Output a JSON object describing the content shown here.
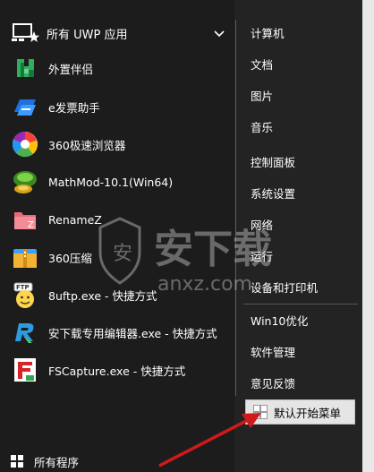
{
  "header": {
    "label": "所有 UWP 应用"
  },
  "apps": [
    {
      "label": "外置伴侣",
      "icon": "green-app-icon"
    },
    {
      "label": "e发票助手",
      "icon": "blue-invoice-icon"
    },
    {
      "label": "360极速浏览器",
      "icon": "360-browser-icon"
    },
    {
      "label": "MathMod-10.1(Win64)",
      "icon": "mathmod-icon"
    },
    {
      "label": "RenameZ",
      "icon": "renamez-icon"
    },
    {
      "label": "360压缩",
      "icon": "360-zip-icon"
    },
    {
      "label": "8uftp.exe - 快捷方式",
      "icon": "8uftp-icon"
    },
    {
      "label": "安下载专用编辑器.exe - 快捷方式",
      "icon": "editor-icon"
    },
    {
      "label": "FSCapture.exe - 快捷方式",
      "icon": "fscapture-icon"
    }
  ],
  "all_programs": "所有程序",
  "right_menu": {
    "group1": [
      "计算机",
      "文档",
      "图片",
      "音乐",
      "控制面板",
      "系统设置",
      "网络",
      "运行",
      "设备和打印机"
    ],
    "group2": [
      "Win10优化",
      "软件管理",
      "意见反馈"
    ],
    "default_menu": "默认开始菜单"
  },
  "watermark": {
    "text_cn": "安下载",
    "text_en": "anxz.com"
  },
  "colors": {
    "accent_arrow": "#d01a1a",
    "menu_bg": "#1c1c1c",
    "highlight": "#e5e5e5"
  }
}
